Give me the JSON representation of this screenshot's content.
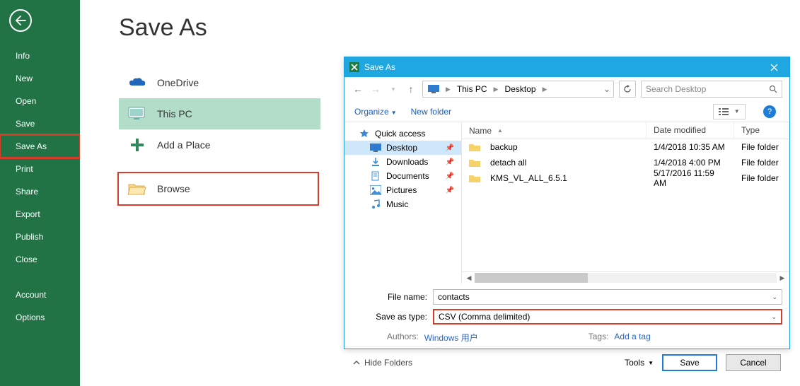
{
  "backstage": {
    "title": "Save As",
    "menu": [
      "Info",
      "New",
      "Open",
      "Save",
      "Save As",
      "Print",
      "Share",
      "Export",
      "Publish",
      "Close",
      "Account",
      "Options"
    ],
    "selected": "Save As",
    "locations": {
      "onedrive": "OneDrive",
      "thispc": "This PC",
      "addplace": "Add a Place",
      "browse": "Browse"
    }
  },
  "dialog": {
    "title": "Save As",
    "breadcrumb": {
      "root": "This PC",
      "leaf": "Desktop"
    },
    "search_placeholder": "Search Desktop",
    "toolbar": {
      "organize": "Organize",
      "newfolder": "New folder"
    },
    "tree": {
      "quick": "Quick access",
      "desktop": "Desktop",
      "downloads": "Downloads",
      "documents": "Documents",
      "pictures": "Pictures",
      "music": "Music"
    },
    "columns": {
      "name": "Name",
      "date": "Date modified",
      "type": "Type"
    },
    "files": [
      {
        "name": "backup",
        "date": "1/4/2018 10:35 AM",
        "type": "File folder"
      },
      {
        "name": "detach all",
        "date": "1/4/2018 4:00 PM",
        "type": "File folder"
      },
      {
        "name": "KMS_VL_ALL_6.5.1",
        "date": "5/17/2016 11:59 AM",
        "type": "File folder"
      }
    ],
    "filename_label": "File name:",
    "filename_value": "contacts",
    "type_label": "Save as type:",
    "type_value": "CSV (Comma delimited)",
    "authors_label": "Authors:",
    "authors_value": "Windows 用户",
    "tags_label": "Tags:",
    "tags_value": "Add a tag",
    "hide_folders": "Hide Folders",
    "tools": "Tools",
    "save": "Save",
    "cancel": "Cancel"
  }
}
